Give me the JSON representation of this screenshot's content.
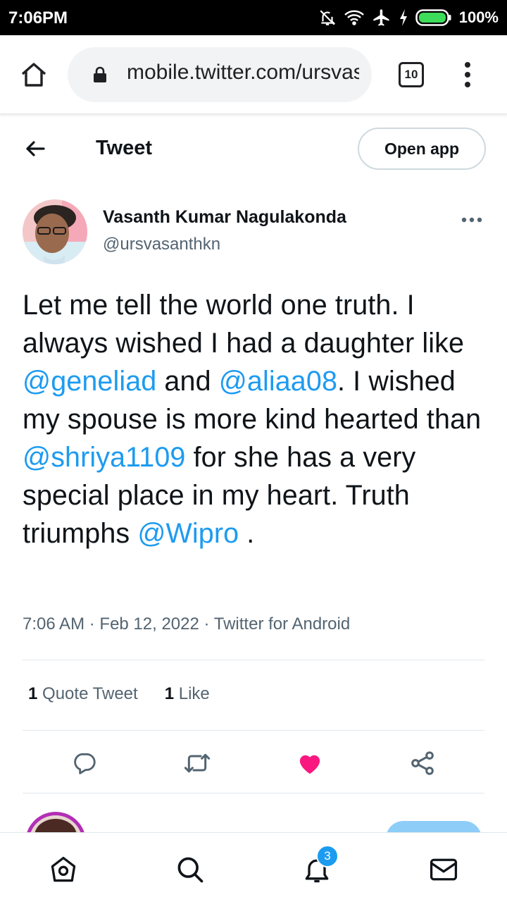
{
  "status_bar": {
    "time": "7:06PM",
    "battery": "100%",
    "icons": [
      "notifications-off-icon",
      "wifi-icon",
      "airplane-icon",
      "charging-icon",
      "battery-icon"
    ]
  },
  "browser": {
    "url": "mobile.twitter.com/ursvasanthkn",
    "tab_count": "10"
  },
  "header": {
    "title": "Tweet",
    "open_app": "Open app"
  },
  "tweet": {
    "author_name": "Vasanth Kumar Nagulakonda",
    "handle": "@ursvasanthkn",
    "text_parts": [
      {
        "text": "Let me tell the world one truth. I always wished I had a daughter like "
      },
      {
        "text": "@geneliad",
        "mention": true
      },
      {
        "text": " and "
      },
      {
        "text": "@aliaa08",
        "mention": true
      },
      {
        "text": ". I wished my spouse is more kind hearted than "
      },
      {
        "text": "@shriya1109",
        "mention": true
      },
      {
        "text": " for she has a very special place in my heart. Truth triumphs "
      },
      {
        "text": "@Wipro",
        "mention": true
      },
      {
        "text": " ."
      }
    ],
    "time": "7:06 AM",
    "date": "Feb 12, 2022",
    "source": "Twitter for Android",
    "meta_separator": "·",
    "quote_tweets_count": "1",
    "quote_tweets_label": "Quote Tweet",
    "likes_count": "1",
    "likes_label": "Like"
  },
  "actions": [
    "reply-icon",
    "retweet-icon",
    "like-icon",
    "share-icon"
  ],
  "bottom_nav": {
    "items": [
      "home-icon",
      "search-icon",
      "notifications-icon",
      "messages-icon"
    ],
    "notifications_badge": "3"
  },
  "colors": {
    "accent": "#1d9bf0",
    "like": "#f91880",
    "text": "#0f1419",
    "secondary_text": "#536471"
  }
}
